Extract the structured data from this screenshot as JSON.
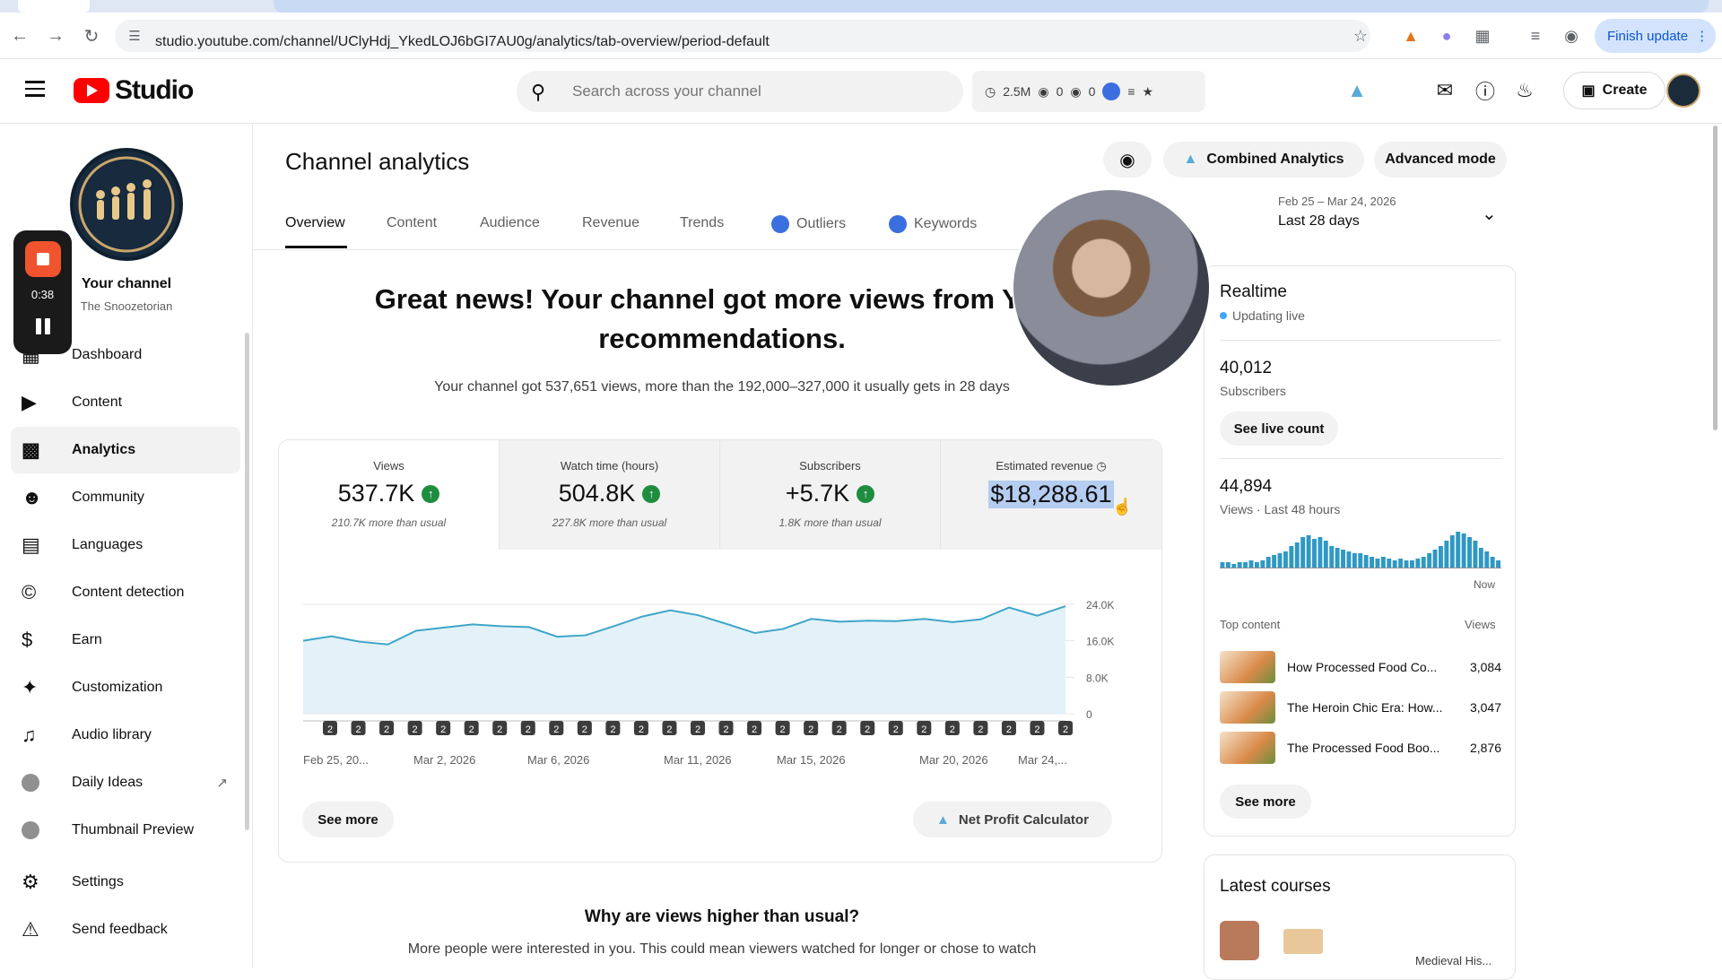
{
  "browser": {
    "url": "studio.youtube.com/channel/UClyHdj_YkedLOJ6bGI7AU0g/analytics/tab-overview/period-default",
    "finish_update": "Finish update",
    "icons": [
      "back-icon",
      "forward-icon",
      "reload-icon",
      "site-info-icon",
      "star-icon",
      "metamask-icon",
      "extension-icon",
      "puzzle-icon",
      "reading-list-icon",
      "profile-icon",
      "more-icon"
    ]
  },
  "header": {
    "logo_text": "Studio",
    "search_placeholder": "Search across your channel",
    "stats": {
      "views": "2.5M",
      "a": "0",
      "b": "0"
    },
    "create_label": "Create"
  },
  "recorder": {
    "time": "0:38"
  },
  "sidebar": {
    "channel_name": "Your channel",
    "channel_handle": "The Snoozetorian",
    "items": [
      {
        "label": "Dashboard",
        "icon": "dashboard-icon"
      },
      {
        "label": "Content",
        "icon": "content-icon"
      },
      {
        "label": "Analytics",
        "icon": "analytics-icon",
        "active": true
      },
      {
        "label": "Community",
        "icon": "community-icon"
      },
      {
        "label": "Languages",
        "icon": "languages-icon"
      },
      {
        "label": "Content detection",
        "icon": "copyright-icon"
      },
      {
        "label": "Earn",
        "icon": "dollar-icon"
      },
      {
        "label": "Customization",
        "icon": "magic-wand-icon"
      },
      {
        "label": "Audio library",
        "icon": "audio-library-icon"
      },
      {
        "label": "Daily Ideas",
        "icon": "ext-icon"
      },
      {
        "label": "Thumbnail Preview",
        "icon": "ext-icon"
      },
      {
        "label": "Settings",
        "icon": "gear-icon"
      },
      {
        "label": "Send feedback",
        "icon": "feedback-icon"
      }
    ]
  },
  "main": {
    "title": "Channel analytics",
    "combined_label": "Combined Analytics",
    "advanced_label": "Advanced mode",
    "tabs": [
      "Overview",
      "Content",
      "Audience",
      "Revenue",
      "Trends",
      "Outliers",
      "Keywords"
    ],
    "date_range": "Feb 25 – Mar 24, 2026",
    "date_label": "Last 28 days",
    "headline_line1": "Great news! Your channel got more views from YouT",
    "headline_line2": "recommendations.",
    "subline": "Your channel got 537,651 views, more than the 192,000–327,000 it usually gets in 28 days",
    "see_more": "See more",
    "net_profit_label": "Net Profit Calculator",
    "why_title": "Why are views higher than usual?",
    "why_text": "More people were interested in you. This could mean viewers watched for longer or chose to watch"
  },
  "metrics": [
    {
      "label": "Views",
      "value": "537.7K",
      "note": "210.7K more than usual",
      "up": true
    },
    {
      "label": "Watch time (hours)",
      "value": "504.8K",
      "note": "227.8K more than usual",
      "up": true
    },
    {
      "label": "Subscribers",
      "value": "+5.7K",
      "note": "1.8K more than usual",
      "up": true
    },
    {
      "label": "Estimated revenue",
      "value": "$18,288.61",
      "note": "",
      "up": false
    }
  ],
  "chart_data": {
    "type": "area",
    "x_labels": [
      "Feb 25, 20...",
      "Mar 2, 2026",
      "Mar 6, 2026",
      "Mar 11, 2026",
      "Mar 15, 2026",
      "Mar 20, 2026",
      "Mar 24,..."
    ],
    "y_ticks": [
      "24.0K",
      "16.0K",
      "8.0K",
      "0"
    ],
    "ylim": [
      0,
      24000
    ],
    "values": [
      16000,
      17000,
      15800,
      15200,
      18200,
      18900,
      19600,
      19200,
      19000,
      16900,
      17200,
      19200,
      21300,
      22700,
      21600,
      19700,
      17700,
      18600,
      20800,
      20200,
      20400,
      20300,
      20800,
      20100,
      20700,
      23300,
      21500,
      23600
    ],
    "marker_label": "2",
    "marker_count": 27,
    "grid": true
  },
  "realtime": {
    "title": "Realtime",
    "live_label": "Updating live",
    "subscribers": "40,012",
    "subscribers_label": "Subscribers",
    "see_live": "See live count",
    "views": "44,894",
    "views_label": "Views · Last 48 hours",
    "now_label": "Now",
    "bars": [
      3,
      3,
      2,
      3,
      3,
      4,
      3,
      4,
      6,
      7,
      8,
      9,
      12,
      14,
      17,
      18,
      16,
      17,
      15,
      12,
      11,
      10,
      9,
      8,
      8,
      7,
      6,
      5,
      6,
      5,
      4,
      5,
      4,
      4,
      5,
      6,
      8,
      10,
      12,
      15,
      18,
      20,
      19,
      17,
      15,
      11,
      9,
      6,
      4
    ],
    "top_content_label": "Top content",
    "views_col_label": "Views",
    "top_content": [
      {
        "title": "How Processed Food Co...",
        "views": "3,084"
      },
      {
        "title": "The Heroin Chic Era: How...",
        "views": "3,047"
      },
      {
        "title": "The Processed Food Boo...",
        "views": "2,876"
      }
    ],
    "see_more": "See more"
  },
  "courses": {
    "title": "Latest courses",
    "item_label": "Medieval His..."
  },
  "colors": {
    "accent": "#ff0000",
    "chart_line": "#3fa5c8",
    "chart_fill": "#e3f2f8",
    "realtime_bar": "#2f98c3",
    "up_green": "#1e8e3e",
    "highlight": "#b4cdf0"
  }
}
